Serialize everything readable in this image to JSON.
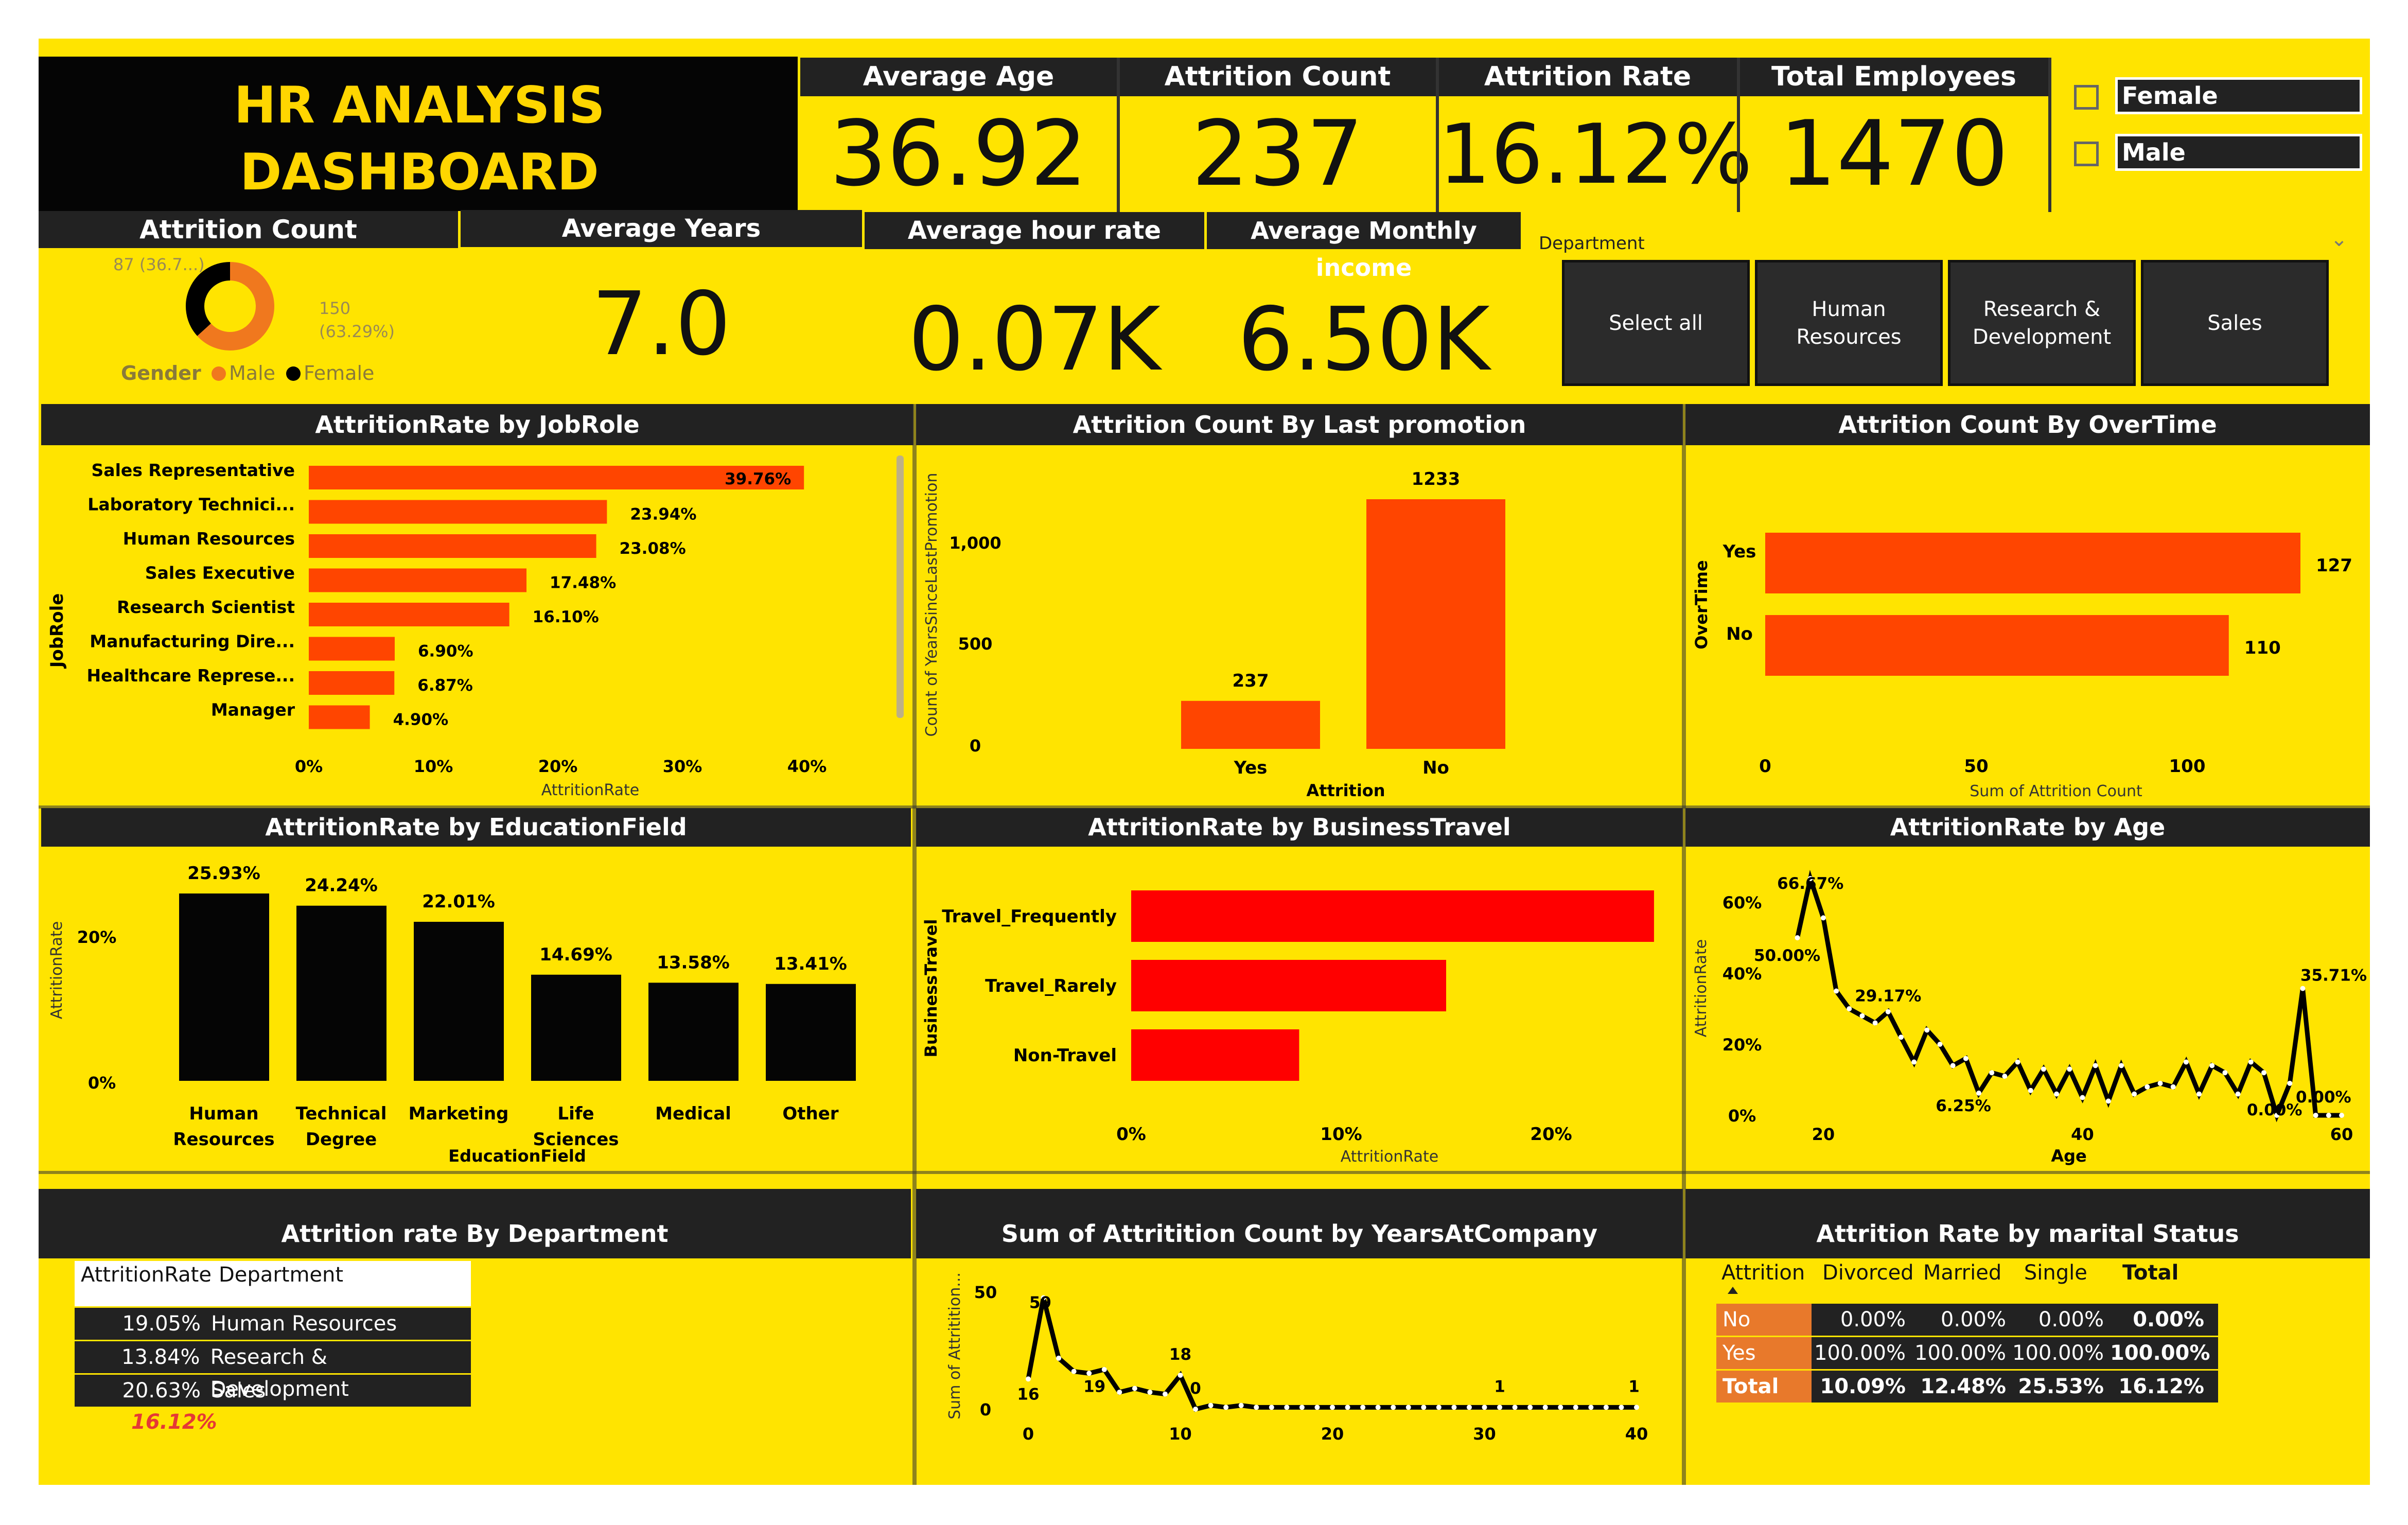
{
  "title": "HR ANALYSIS DASHBOARD",
  "kpis": {
    "average_age": {
      "label": "Average Age",
      "value": "36.92"
    },
    "attrition_count": {
      "label": "Attrition Count",
      "value": "237"
    },
    "attrition_rate": {
      "label": "Attrition Rate",
      "value": "16.12%"
    },
    "total_employees": {
      "label": "Total Employees",
      "value": "1470"
    },
    "average_years": {
      "label": "Average Years",
      "value": "7.0"
    },
    "average_hour_rate": {
      "label": "Average hour rate",
      "value": "0.07K"
    },
    "average_monthly_income": {
      "label": "Average Monthly income",
      "value": "6.50K"
    }
  },
  "gender_slicer": {
    "options": [
      "Female",
      "Male"
    ]
  },
  "department_slicer": {
    "label": "Department",
    "options": [
      {
        "line1": "Select all",
        "line2": ""
      },
      {
        "line1": "Human",
        "line2": "Resources"
      },
      {
        "line1": "Research &",
        "line2": "Development"
      },
      {
        "line1": "Sales",
        "line2": ""
      }
    ]
  },
  "colors": {
    "panel": "#FFE400",
    "header": "#222222",
    "bar": "#FF4500",
    "bar_red": "#FF0000",
    "black": "#050505",
    "table_orange": "#E8792B"
  },
  "chart_data": [
    {
      "id": "gender_donut",
      "type": "pie",
      "title": "Attrition Count",
      "legend_title": "Gender",
      "categories": [
        "Male",
        "Female"
      ],
      "values": [
        150,
        87
      ],
      "labels": [
        "150 (63.29%)",
        "87 (36.7...)"
      ],
      "label_parts": {
        "male_count": "150",
        "male_pct": "(63.29%)",
        "female": "87 (36.7...)"
      },
      "colors": [
        "#F0781E",
        "#000000"
      ]
    },
    {
      "id": "jobrole",
      "type": "bar",
      "orientation": "horizontal",
      "title": "AttritionRate by JobRole",
      "xlabel": "AttritionRate",
      "ylabel": "JobRole",
      "categories": [
        "Sales Representative",
        "Laboratory Technici...",
        "Human Resources",
        "Sales Executive",
        "Research Scientist",
        "Manufacturing Dire...",
        "Healthcare Represe...",
        "Manager"
      ],
      "values": [
        39.76,
        23.94,
        23.08,
        17.48,
        16.1,
        6.9,
        6.87,
        4.9
      ],
      "value_labels": [
        "39.76%",
        "23.94%",
        "23.08%",
        "17.48%",
        "16.10%",
        "6.90%",
        "6.87%",
        "4.90%"
      ],
      "ticks": [
        "0%",
        "10%",
        "20%",
        "30%",
        "40%"
      ],
      "xlim": [
        0,
        40
      ]
    },
    {
      "id": "promotion",
      "type": "bar",
      "title": "Attrition Count By Last promotion",
      "xlabel": "Attrition",
      "ylabel": "Count of YearsSinceLastPromotion",
      "categories": [
        "Yes",
        "No"
      ],
      "values": [
        237,
        1233
      ],
      "value_labels": [
        "237",
        "1233"
      ],
      "ticks": [
        "0",
        "500",
        "1,000"
      ],
      "ylim": [
        0,
        1233
      ]
    },
    {
      "id": "overtime",
      "type": "bar",
      "orientation": "horizontal",
      "title": "Attrition Count By OverTime",
      "xlabel": "Sum of Attrition Count",
      "ylabel": "OverTime",
      "categories": [
        "Yes",
        "No"
      ],
      "values": [
        127,
        110
      ],
      "value_labels": [
        "127",
        "110"
      ],
      "ticks": [
        "0",
        "50",
        "100"
      ],
      "xlim": [
        0,
        127
      ]
    },
    {
      "id": "education",
      "type": "bar",
      "title": "AttritionRate by EducationField",
      "xlabel": "EducationField",
      "ylabel": "AttritionRate",
      "categories": [
        [
          "Human",
          "Resources"
        ],
        [
          "Technical",
          "Degree"
        ],
        [
          "Marketing",
          ""
        ],
        [
          "Life",
          "Sciences"
        ],
        [
          "Medical",
          ""
        ],
        [
          "Other",
          ""
        ]
      ],
      "values": [
        25.93,
        24.24,
        22.01,
        14.69,
        13.58,
        13.41
      ],
      "value_labels": [
        "25.93%",
        "24.24%",
        "22.01%",
        "14.69%",
        "13.58%",
        "13.41%"
      ],
      "ticks": [
        "0%",
        "20%"
      ],
      "ylim": [
        0,
        25.93
      ]
    },
    {
      "id": "travel",
      "type": "bar",
      "orientation": "horizontal",
      "title": "AttritionRate by BusinessTravel",
      "xlabel": "AttritionRate",
      "ylabel": "BusinessTravel",
      "categories": [
        "Travel_Frequently",
        "Travel_Rarely",
        "Non-Travel"
      ],
      "values": [
        24.9,
        15.0,
        8.0
      ],
      "ticks": [
        "0%",
        "10%",
        "20%"
      ],
      "xlim": [
        0,
        25
      ]
    },
    {
      "id": "age",
      "type": "line",
      "title": "AttritionRate by Age",
      "xlabel": "Age",
      "ylabel": "AttritionRate",
      "x": [
        18,
        19,
        20,
        21,
        22,
        23,
        24,
        25,
        26,
        27,
        28,
        29,
        30,
        31,
        32,
        33,
        34,
        35,
        36,
        37,
        38,
        39,
        40,
        41,
        42,
        43,
        44,
        45,
        46,
        47,
        48,
        49,
        50,
        51,
        52,
        53,
        54,
        55,
        56,
        57,
        58,
        59,
        60
      ],
      "y": [
        50.0,
        66.67,
        55.6,
        35.0,
        30.0,
        28.0,
        26.0,
        29.17,
        22.0,
        15.0,
        24.0,
        20.0,
        14.0,
        16.0,
        6.25,
        12.0,
        11.0,
        15.0,
        7.0,
        13.0,
        6.0,
        13.0,
        5.0,
        14.0,
        4.0,
        14.0,
        6.0,
        8.0,
        9.0,
        8.0,
        15.0,
        6.0,
        14.0,
        12.0,
        6.0,
        15.0,
        12.0,
        0.0,
        9.0,
        35.71,
        0.0,
        0.0,
        0.0
      ],
      "point_labels": [
        "66.67%",
        "50.00%",
        "29.17%",
        "6.25%",
        "35.71%",
        "0.00%",
        "0.00%"
      ],
      "ticks_x": [
        "20",
        "40",
        "60"
      ],
      "ticks_y": [
        "0%",
        "20%",
        "40%",
        "60%"
      ],
      "ylim": [
        0,
        70
      ],
      "xlim": [
        15,
        60
      ]
    },
    {
      "id": "years",
      "type": "line",
      "title": "Sum of Attritition Count by YearsAtCompany",
      "xlabel": "",
      "ylabel": "Sum of Attritition...",
      "x": [
        0,
        1,
        2,
        3,
        4,
        5,
        6,
        7,
        8,
        9,
        10,
        11,
        12,
        13,
        14,
        15,
        16,
        17,
        18,
        19,
        20,
        21,
        22,
        23,
        24,
        25,
        26,
        27,
        28,
        29,
        30,
        31,
        32,
        33,
        34,
        35,
        36,
        37,
        38,
        39,
        40
      ],
      "y": [
        16,
        59,
        27,
        20,
        19,
        21,
        9,
        11,
        9,
        8,
        18,
        0,
        2,
        1,
        2,
        1,
        1,
        1,
        1,
        1,
        1,
        1,
        1,
        1,
        1,
        1,
        1,
        1,
        1,
        1,
        1,
        1,
        1,
        1,
        1,
        1,
        1,
        1,
        1,
        1,
        1
      ],
      "point_labels": [
        "59",
        "16",
        "19",
        "18",
        "0",
        "1",
        "1"
      ],
      "ticks_x": [
        "0",
        "10",
        "20",
        "30",
        "40"
      ],
      "ticks_y": [
        "0",
        "50"
      ],
      "ylim": [
        0,
        60
      ],
      "xlim": [
        0,
        40
      ]
    },
    {
      "id": "department",
      "type": "table",
      "title": "Attrition rate By Department",
      "columns": [
        "AttritionRate",
        "Department"
      ],
      "rows": [
        [
          "19.05%",
          "Human Resources"
        ],
        [
          "13.84%",
          "Research & Development"
        ],
        [
          "20.63%",
          "Sales"
        ]
      ],
      "total": "16.12%"
    },
    {
      "id": "marital",
      "type": "table",
      "title": "Attrition Rate by marital Status",
      "columns": [
        "Attrition",
        "Divorced",
        "Married",
        "Single",
        "Total"
      ],
      "rows": [
        [
          "No",
          "0.00%",
          "0.00%",
          "0.00%",
          "0.00%"
        ],
        [
          "Yes",
          "100.00%",
          "100.00%",
          "100.00%",
          "100.00%"
        ]
      ],
      "total_row": [
        "Total",
        "10.09%",
        "12.48%",
        "25.53%",
        "16.12%"
      ]
    }
  ]
}
